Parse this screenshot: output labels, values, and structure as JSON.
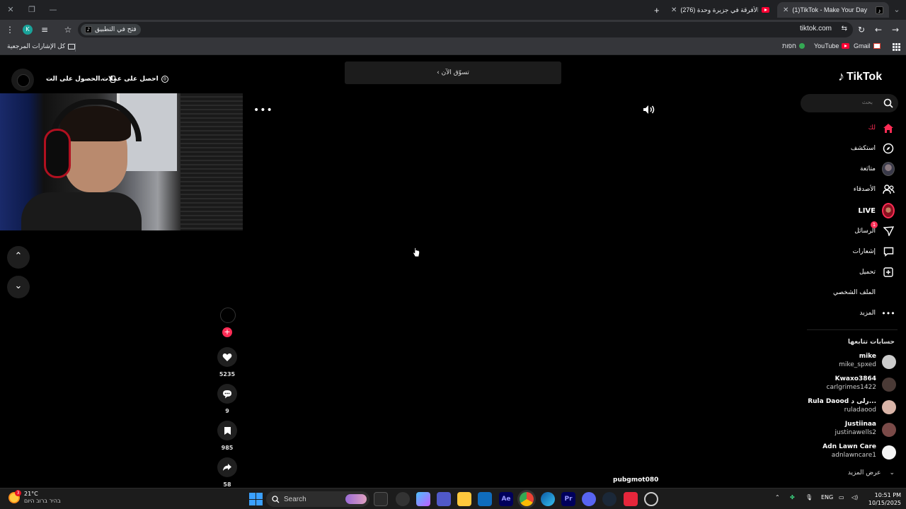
{
  "browser": {
    "tabs": [
      {
        "title": "(1)TikTok - Make Your Day",
        "active": true
      },
      {
        "title": "(276) كل الأفرقة في جزيرة وحدة!",
        "active": false
      }
    ],
    "new_tab": "+",
    "address": {
      "open_in_app": "فتح في التطبيق",
      "url": "tiktok.com",
      "profile_initial": "K"
    },
    "bookmarks": {
      "all_bookmarks": "كل الإشارات المرجعية",
      "items": [
        "Gmail",
        "YouTube",
        "חפות"
      ]
    }
  },
  "tiktok": {
    "top_bar": {
      "shop_now": "تسوّق الآن",
      "get_app": "الحصول على الت...",
      "get_coins": "احصل على عملات"
    },
    "logo": "TikTok",
    "search_placeholder": "بحث",
    "nav": [
      {
        "label": "لك",
        "icon": "home-icon"
      },
      {
        "label": "استكشف",
        "icon": "explore-icon"
      },
      {
        "label": "متابَعة",
        "icon": "following-avatar-icon"
      },
      {
        "label": "الأصدقاء",
        "icon": "friends-icon"
      },
      {
        "label": "LIVE",
        "icon": "live-avatar-icon"
      },
      {
        "label": "الرسائل",
        "icon": "messages-icon",
        "badge": "1"
      },
      {
        "label": "إشعارات",
        "icon": "notifications-icon"
      },
      {
        "label": "تحميل",
        "icon": "upload-icon"
      },
      {
        "label": "الملف الشخصي",
        "icon": "profile-icon"
      },
      {
        "label": "المزيد",
        "icon": "more-icon"
      }
    ],
    "following_title": "حسابات تتابعها",
    "following": [
      {
        "name": "mike",
        "user": "mike_spxed"
      },
      {
        "name": "Kwaxo3864",
        "user": "carlgrimes1422"
      },
      {
        "name": "Rula Daood رلى د...",
        "user": "ruladaood"
      },
      {
        "name": "Justiinaa",
        "user": "justinawells2"
      },
      {
        "name": "Adn Lawn Care",
        "user": "adnlawncare1"
      }
    ],
    "see_more": "عرض المزيد",
    "video": {
      "author": "pubgmot080",
      "likes": "5235",
      "comments": "9",
      "saves": "985",
      "shares": "58"
    }
  },
  "taskbar": {
    "weather_temp": "21°C",
    "weather_cond": "בהיר ברוב היום",
    "weather_badge": "3",
    "search": "Search",
    "lang": "ENG",
    "time": "10:51 PM",
    "date": "10/15/2025"
  },
  "colors": {
    "tiktok_red": "#fe2c55",
    "page_bg": "#000000",
    "chrome_dark": "#202124"
  }
}
